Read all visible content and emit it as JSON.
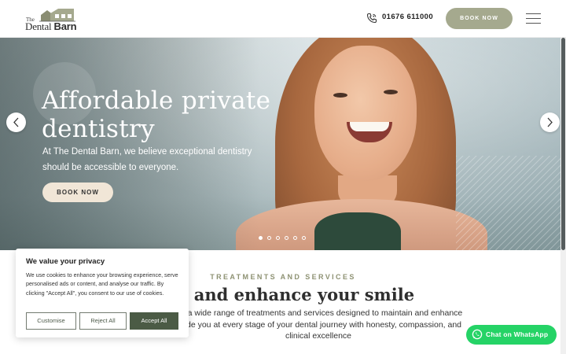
{
  "header": {
    "logo": {
      "small": "The",
      "name_light": "Dental",
      "name_bold": "Barn"
    },
    "phone_icon": "phone-icon",
    "phone": "01676 611000",
    "book_label": "BOOK NOW",
    "menu_icon": "hamburger-icon"
  },
  "hero": {
    "title_line1": "Affordable private",
    "title_line2": "dentistry",
    "subtitle": "At The Dental Barn, we believe exceptional dentistry should be accessible to everyone.",
    "cta": "BOOK NOW",
    "prev_icon": "chevron-left-icon",
    "next_icon": "chevron-right-icon",
    "slides_total": 6,
    "active_slide": 1
  },
  "treatments": {
    "eyebrow": "TREATMENTS AND SERVICES",
    "title": "tain and enhance your smile",
    "body_line1": "ide a wide range of treatments and services designed to maintain and enhance",
    "body_line2": "guide you at every stage of your dental journey with honesty, compassion, and",
    "body_line3": "clinical excellence"
  },
  "cookie": {
    "title": "We value your privacy",
    "text": "We use cookies to enhance your browsing experience, serve personalised ads or content, and analyse our traffic. By clicking \"Accept All\", you consent to our use of cookies.",
    "customise": "Customise",
    "reject": "Reject All",
    "accept": "Accept All"
  },
  "whatsapp": {
    "label": "Chat on WhatsApp",
    "icon": "whatsapp-icon"
  },
  "colors": {
    "accent": "#a5a98e",
    "eyebrow": "#8e9273",
    "cookie_accept": "#4b5b45",
    "whatsapp": "#25d366",
    "hero_cta": "#f1e6d7"
  }
}
